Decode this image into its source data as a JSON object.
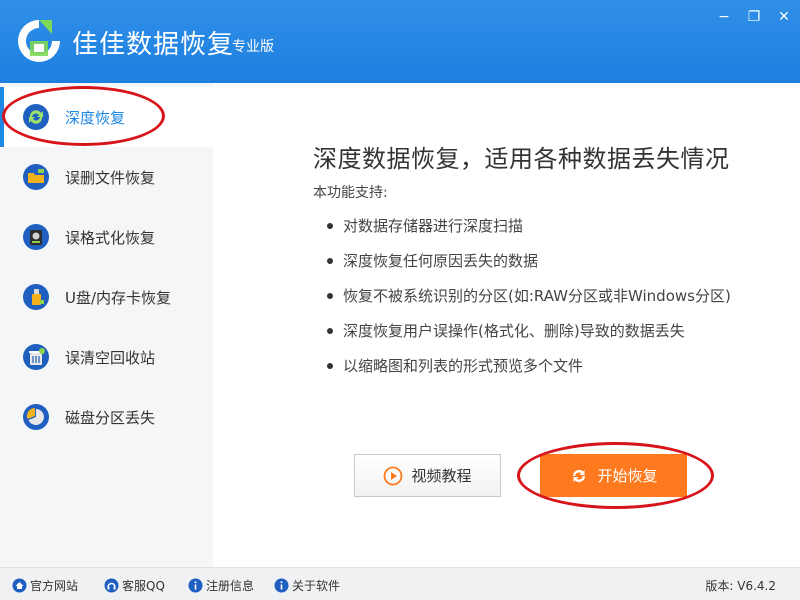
{
  "app": {
    "title": "佳佳数据恢复",
    "edition": "专业版"
  },
  "window": {
    "minimize": "−",
    "restore": "❐",
    "close": "✕"
  },
  "sidebar": {
    "items": [
      {
        "label": "深度恢复",
        "icon": "refresh-icon",
        "active": true
      },
      {
        "label": "误删文件恢复",
        "icon": "folder-icon"
      },
      {
        "label": "误格式化恢复",
        "icon": "disk-icon"
      },
      {
        "label": "U盘/内存卡恢复",
        "icon": "usb-icon"
      },
      {
        "label": "误清空回收站",
        "icon": "recycle-bin-icon"
      },
      {
        "label": "磁盘分区丢失",
        "icon": "pie-chart-icon"
      }
    ]
  },
  "main": {
    "headline": "深度数据恢复，适用各种数据丢失情况",
    "subhead": "本功能支持:",
    "features": [
      "对数据存储器进行深度扫描",
      "深度恢复任何原因丢失的数据",
      "恢复不被系统识别的分区(如:RAW分区或非Windows分区)",
      "深度恢复用户误操作(格式化、删除)导致的数据丢失",
      "以缩略图和列表的形式预览多个文件"
    ],
    "video_button": "视频教程",
    "start_button": "开始恢复"
  },
  "statusbar": {
    "links": [
      "官方网站",
      "客服QQ",
      "注册信息",
      "关于软件"
    ],
    "version": "版本: V6.4.2"
  },
  "colors": {
    "brand": "#1f7fe0",
    "accent": "#ff7a1e",
    "annotation": "#d8141b"
  }
}
